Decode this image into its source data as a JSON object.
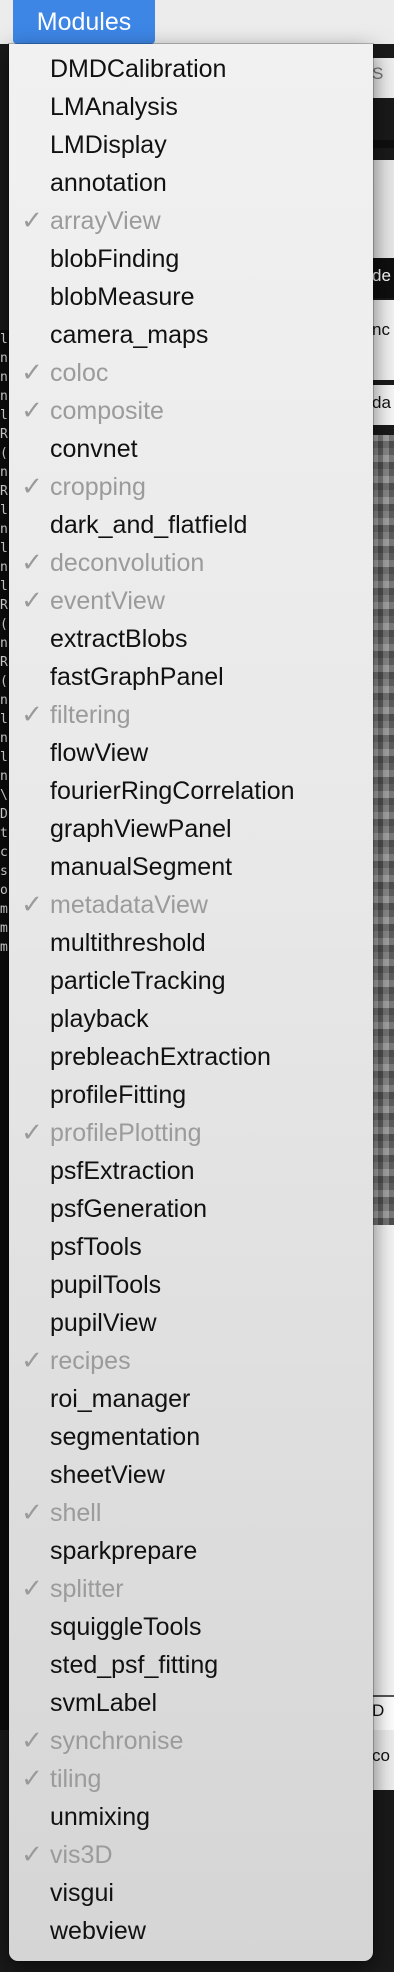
{
  "menubar": {
    "title": "Modules"
  },
  "background": {
    "right_fragments": [
      "S",
      "de",
      "nc",
      "da",
      "D",
      "co"
    ],
    "terminal_lines": [
      "l",
      "n",
      "n",
      "n",
      "l",
      "R",
      "(",
      "n",
      "R",
      "l",
      "n",
      "l",
      "n",
      "l",
      "R",
      "(",
      "n",
      "R",
      "(",
      "n",
      "l",
      "n",
      "l",
      "n",
      "\\",
      "D",
      "",
      "",
      "",
      "",
      "",
      "",
      "",
      "",
      "",
      "t",
      "",
      "c",
      "s",
      "o",
      "m",
      "m",
      "m"
    ]
  },
  "menu": {
    "check_glyph": "✓",
    "items": [
      {
        "label": "DMDCalibration",
        "checked": false
      },
      {
        "label": "LMAnalysis",
        "checked": false
      },
      {
        "label": "LMDisplay",
        "checked": false
      },
      {
        "label": "annotation",
        "checked": false
      },
      {
        "label": "arrayView",
        "checked": true
      },
      {
        "label": "blobFinding",
        "checked": false
      },
      {
        "label": "blobMeasure",
        "checked": false
      },
      {
        "label": "camera_maps",
        "checked": false
      },
      {
        "label": "coloc",
        "checked": true
      },
      {
        "label": "composite",
        "checked": true
      },
      {
        "label": "convnet",
        "checked": false
      },
      {
        "label": "cropping",
        "checked": true
      },
      {
        "label": "dark_and_flatfield",
        "checked": false
      },
      {
        "label": "deconvolution",
        "checked": true
      },
      {
        "label": "eventView",
        "checked": true
      },
      {
        "label": "extractBlobs",
        "checked": false
      },
      {
        "label": "fastGraphPanel",
        "checked": false
      },
      {
        "label": "filtering",
        "checked": true
      },
      {
        "label": "flowView",
        "checked": false
      },
      {
        "label": "fourierRingCorrelation",
        "checked": false
      },
      {
        "label": "graphViewPanel",
        "checked": false
      },
      {
        "label": "manualSegment",
        "checked": false
      },
      {
        "label": "metadataView",
        "checked": true
      },
      {
        "label": "multithreshold",
        "checked": false
      },
      {
        "label": "particleTracking",
        "checked": false
      },
      {
        "label": "playback",
        "checked": false
      },
      {
        "label": "prebleachExtraction",
        "checked": false
      },
      {
        "label": "profileFitting",
        "checked": false
      },
      {
        "label": "profilePlotting",
        "checked": true
      },
      {
        "label": "psfExtraction",
        "checked": false
      },
      {
        "label": "psfGeneration",
        "checked": false
      },
      {
        "label": "psfTools",
        "checked": false
      },
      {
        "label": "pupilTools",
        "checked": false
      },
      {
        "label": "pupilView",
        "checked": false
      },
      {
        "label": "recipes",
        "checked": true
      },
      {
        "label": "roi_manager",
        "checked": false
      },
      {
        "label": "segmentation",
        "checked": false
      },
      {
        "label": "sheetView",
        "checked": false
      },
      {
        "label": "shell",
        "checked": true
      },
      {
        "label": "sparkprepare",
        "checked": false
      },
      {
        "label": "splitter",
        "checked": true
      },
      {
        "label": "squiggleTools",
        "checked": false
      },
      {
        "label": "sted_psf_fitting",
        "checked": false
      },
      {
        "label": "svmLabel",
        "checked": false
      },
      {
        "label": "synchronise",
        "checked": true
      },
      {
        "label": "tiling",
        "checked": true
      },
      {
        "label": "unmixing",
        "checked": false
      },
      {
        "label": "vis3D",
        "checked": true
      },
      {
        "label": "visgui",
        "checked": false
      },
      {
        "label": "webview",
        "checked": false
      }
    ]
  }
}
